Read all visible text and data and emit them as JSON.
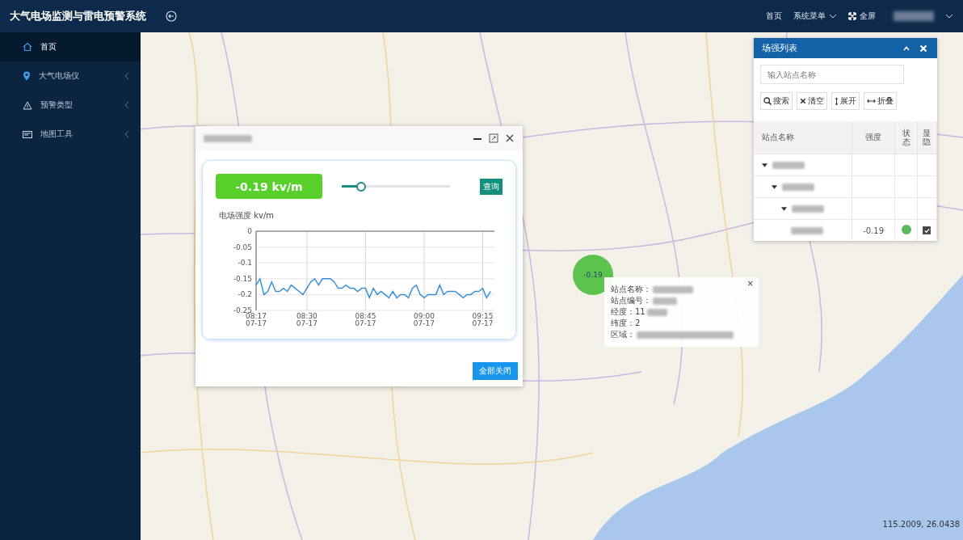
{
  "header": {
    "title": "大气电场监测与雷电预警系统",
    "nav": [
      {
        "label": "首页",
        "kind": "link"
      },
      {
        "label": "系统菜单",
        "kind": "dropdown"
      },
      {
        "label": "全屏",
        "kind": "fullscreen"
      }
    ]
  },
  "sidebar": {
    "items": [
      {
        "label": "首页",
        "selected": true,
        "expandable": false
      },
      {
        "label": "大气电场仪",
        "selected": false,
        "expandable": true
      },
      {
        "label": "预警类型",
        "selected": false,
        "expandable": true
      },
      {
        "label": "地图工具",
        "selected": false,
        "expandable": true
      }
    ]
  },
  "station_window": {
    "reading": "-0.19 kv/m",
    "slider": {
      "level": 0.15
    },
    "query_button": "查询",
    "close_all_button": "全部关闭",
    "chart_data": {
      "type": "line",
      "ylabel": "电场强度 kv/m",
      "grid": true,
      "ylim": [
        -0.25,
        0
      ],
      "yticks": [
        0,
        -0.05,
        -0.1,
        -0.15,
        -0.2,
        -0.25
      ],
      "categories": [
        "08:17 07-17",
        null,
        null,
        null,
        null,
        null,
        null,
        null,
        null,
        null,
        null,
        null,
        null,
        "08:30 07-17",
        null,
        null,
        null,
        null,
        null,
        null,
        null,
        null,
        null,
        null,
        null,
        null,
        null,
        null,
        "08:45 07-17",
        null,
        null,
        null,
        null,
        null,
        null,
        null,
        null,
        null,
        null,
        null,
        null,
        null,
        null,
        "09:00 07-17",
        null,
        null,
        null,
        null,
        null,
        null,
        null,
        null,
        null,
        null,
        null,
        null,
        null,
        null,
        "09:15 07-17",
        null,
        null
      ],
      "series": [
        {
          "color": "#3b8fd6",
          "values": [
            -0.17,
            -0.15,
            -0.2,
            -0.19,
            -0.16,
            -0.19,
            -0.19,
            -0.18,
            -0.19,
            -0.17,
            -0.18,
            -0.19,
            -0.2,
            -0.18,
            -0.16,
            -0.15,
            -0.17,
            -0.15,
            -0.15,
            -0.15,
            -0.16,
            -0.18,
            -0.18,
            -0.17,
            -0.18,
            -0.18,
            -0.19,
            -0.18,
            -0.18,
            -0.21,
            -0.18,
            -0.2,
            -0.19,
            -0.2,
            -0.21,
            -0.19,
            -0.21,
            -0.2,
            -0.2,
            -0.21,
            -0.18,
            -0.17,
            -0.2,
            -0.21,
            -0.2,
            -0.2,
            -0.2,
            -0.17,
            -0.2,
            -0.19,
            -0.19,
            -0.19,
            -0.2,
            -0.21,
            -0.2,
            -0.2,
            -0.19,
            -0.19,
            -0.18,
            -0.21,
            -0.19
          ]
        }
      ]
    }
  },
  "marker": {
    "label": "-0.19",
    "color": "#5cc34f"
  },
  "popup": {
    "close": "×",
    "fields": [
      "站点名称：",
      "站点编号：",
      "经度：11",
      "纬度：2",
      "区域："
    ]
  },
  "field_list": {
    "title": "场强列表",
    "search": {
      "placeholder": "输入站点名称"
    },
    "buttons": [
      "搜索",
      "清空",
      "展开",
      "折叠"
    ],
    "columns": [
      "站点名称",
      "强度",
      "状态",
      "显隐"
    ],
    "tree": [
      {
        "expanded": true,
        "children": [
          {
            "expanded": true,
            "children": [
              {
                "expanded": true,
                "children": [
                  {
                    "strength": "-0.19",
                    "color": "#5cb85c",
                    "checked": true
                  }
                ]
              }
            ]
          }
        ]
      }
    ]
  },
  "coordinates": "115.2009, 26.0438"
}
